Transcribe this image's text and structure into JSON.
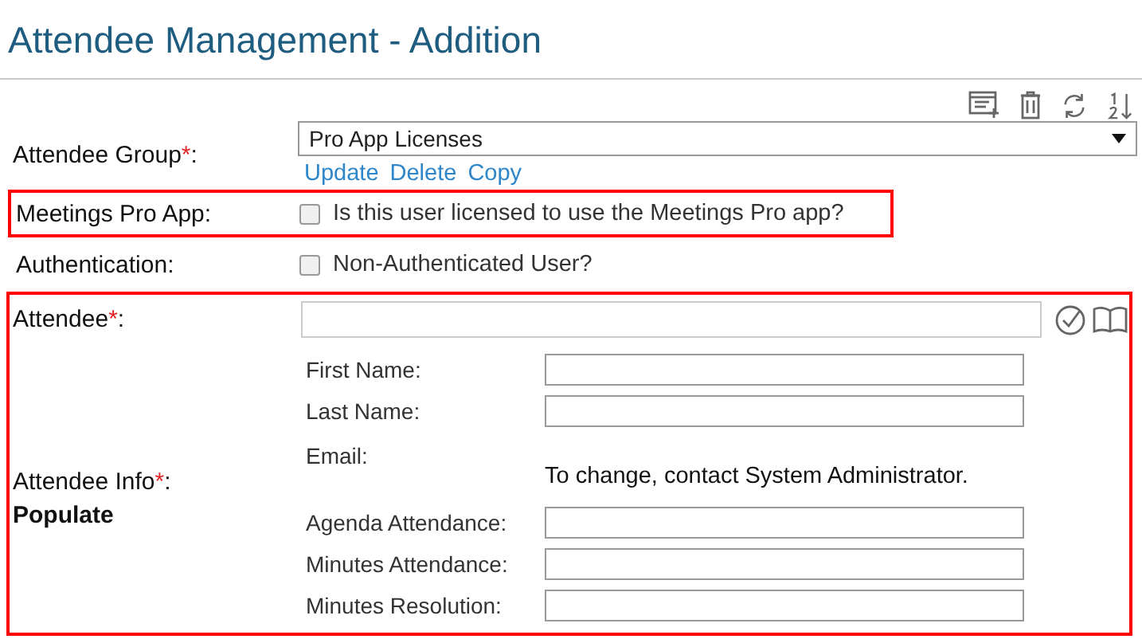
{
  "title": "Attendee Management - Addition",
  "group": {
    "label": "Attendee Group",
    "required_mark": "*",
    "colon": ":",
    "value": "Pro App Licenses",
    "links": [
      "Update",
      "Delete",
      "Copy"
    ]
  },
  "options": [
    {
      "label": "Meetings Pro App:",
      "text": "Is this user licensed to use the Meetings Pro app?",
      "checked": false,
      "highlighted": true
    },
    {
      "label": "Authentication:",
      "text": "Non-Authenticated User?",
      "checked": false,
      "highlighted": false
    }
  ],
  "attendee_section": {
    "highlighted": true,
    "attendee": {
      "label": "Attendee",
      "required_mark": "*",
      "colon": ":"
    },
    "info": {
      "label": "Attendee Info",
      "required_mark": "*",
      "colon": ":",
      "sub": "Populate"
    },
    "fields": [
      {
        "kind": "input",
        "label": "First Name:"
      },
      {
        "kind": "input",
        "label": "Last Name:"
      },
      {
        "kind": "note",
        "label": "Email:",
        "note": "To change, contact System Administrator."
      },
      {
        "kind": "input",
        "label": "Agenda Attendance:"
      },
      {
        "kind": "input",
        "label": "Minutes Attendance:"
      },
      {
        "kind": "input",
        "label": "Minutes Resolution:"
      }
    ]
  }
}
